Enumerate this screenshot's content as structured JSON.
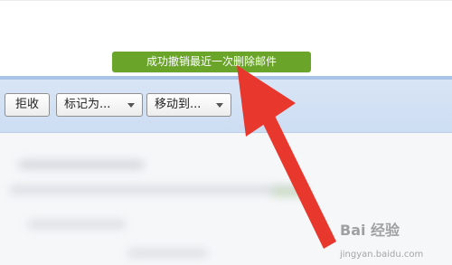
{
  "toast": {
    "message": "成功撤销最近一次删除邮件",
    "color": "#6aa52a"
  },
  "toolbar": {
    "reject_label": "拒收",
    "mark_as_label": "标记为...",
    "move_to_label": "移动到..."
  },
  "watermark": {
    "logo_text": "Bai 经验",
    "url": "jingyan.baidu.com"
  },
  "annotation": {
    "arrow_color": "#e8382e"
  }
}
